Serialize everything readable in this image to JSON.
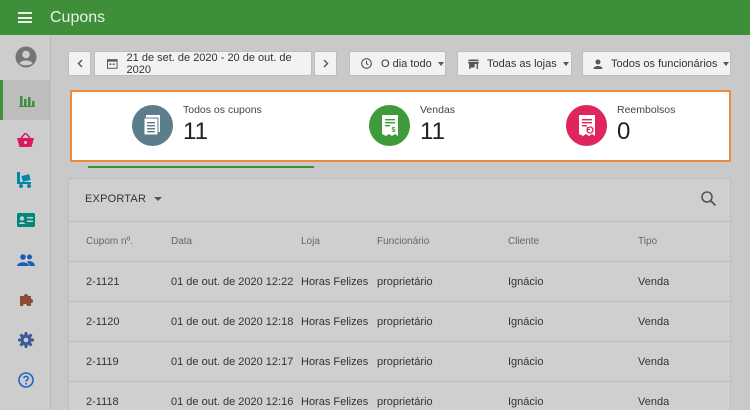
{
  "app": {
    "title": "Cupons"
  },
  "toolbar": {
    "date_range": "21 de set. de 2020 - 20 de out. de 2020",
    "time_filter": "O dia todo",
    "store_filter": "Todas as lojas",
    "employee_filter": "Todos os funcionários"
  },
  "summary": {
    "all": {
      "label": "Todos os cupons",
      "value": "11",
      "color": "#5b7d8c"
    },
    "sales": {
      "label": "Vendas",
      "value": "11",
      "color": "#3f9a3c"
    },
    "refunds": {
      "label": "Reembolsos",
      "value": "0",
      "color": "#e0245e"
    }
  },
  "table": {
    "export_label": "EXPORTAR",
    "headers": {
      "number": "Cupom nº.",
      "date": "Data",
      "store": "Loja",
      "employee": "Funcionário",
      "customer": "Cliente",
      "type": "Tipo"
    },
    "rows": [
      {
        "number": "2-1121",
        "date": "01 de out. de 2020 12:22",
        "store": "Horas Felizes",
        "employee": "proprietário",
        "customer": "Ignácio",
        "type": "Venda"
      },
      {
        "number": "2-1120",
        "date": "01 de out. de 2020 12:18",
        "store": "Horas Felizes",
        "employee": "proprietário",
        "customer": "Ignácio",
        "type": "Venda"
      },
      {
        "number": "2-1119",
        "date": "01 de out. de 2020 12:17",
        "store": "Horas Felizes",
        "employee": "proprietário",
        "customer": "Ignácio",
        "type": "Venda"
      },
      {
        "number": "2-1118",
        "date": "01 de out. de 2020 12:16",
        "store": "Horas Felizes",
        "employee": "proprietário",
        "customer": "Ignácio",
        "type": "Venda"
      }
    ]
  },
  "colors": {
    "brand": "#3f8f3a",
    "highlight": "#ee8a3c"
  },
  "icons": [
    "menu-icon",
    "user-icon",
    "reports-icon",
    "basket-icon",
    "items-icon",
    "customer-card-icon",
    "employees-icon",
    "integrations-icon",
    "settings-icon",
    "help-icon",
    "calendar-icon",
    "clock-icon",
    "store-icon",
    "person-icon",
    "search-icon",
    "receipt-icon",
    "receipt-dollar-icon",
    "receipt-refund-icon"
  ]
}
